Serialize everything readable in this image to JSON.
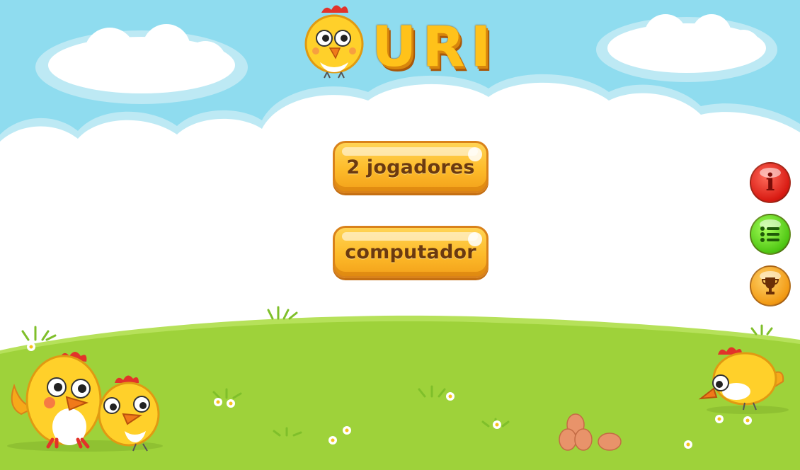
{
  "logo": {
    "title": "URI"
  },
  "menu": {
    "two_players_label": "2 jogadores",
    "computer_label": "computador"
  },
  "side_buttons": {
    "info_glyph": "i",
    "list_icon": "list-icon",
    "trophy_icon": "trophy-icon"
  },
  "colors": {
    "sky": "#8fdcef",
    "cloud": "#ffffff",
    "grass": "#9ed23a",
    "button_gold": "#fdbb2a",
    "button_text": "#6b3a10",
    "info_red": "#d81a12",
    "list_green": "#4fc613",
    "trophy_orange": "#f29a14"
  }
}
